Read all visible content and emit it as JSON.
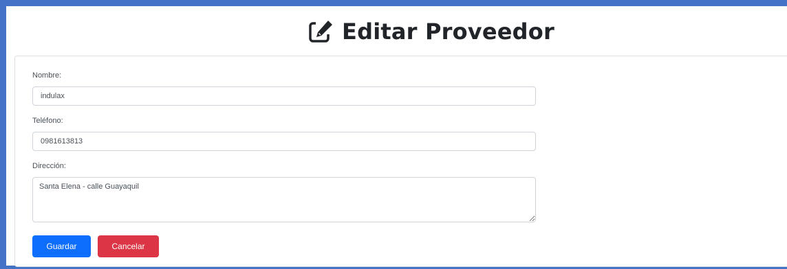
{
  "header": {
    "title": "Editar Proveedor",
    "icon": "pencil-square-icon"
  },
  "form": {
    "name_label": "Nombre:",
    "name_value": "indulax",
    "phone_label": "Teléfono:",
    "phone_value": "0981613813",
    "address_label": "Dirección:",
    "address_value": "Santa Elena - calle Guayaquil",
    "save_label": "Guardar",
    "cancel_label": "Cancelar"
  },
  "colors": {
    "frame_border": "#4472c4",
    "primary": "#0d6efd",
    "danger": "#dc3545"
  }
}
